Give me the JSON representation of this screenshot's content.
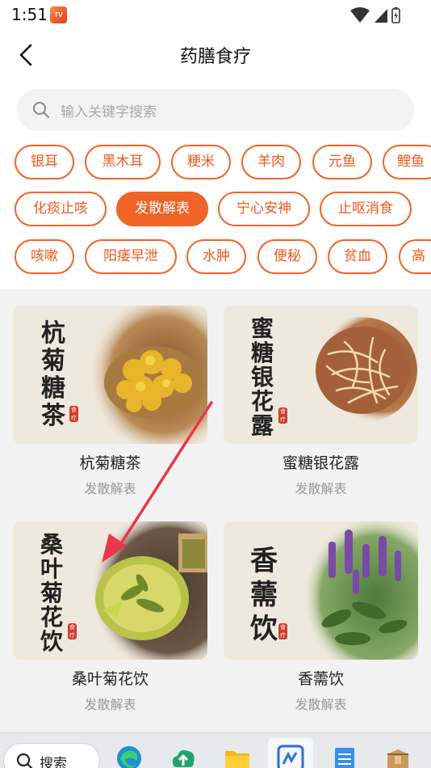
{
  "status": {
    "time": "1:51",
    "app_badge": "TV"
  },
  "header": {
    "title": "药膳食疗"
  },
  "search": {
    "placeholder": "输入关键字搜索"
  },
  "tag_rows": [
    [
      "银耳",
      "黑木耳",
      "粳米",
      "羊肉",
      "元鱼",
      "鲤鱼"
    ],
    [
      "化痰止咳",
      "发散解表",
      "宁心安神",
      "止呕消食"
    ],
    [
      "咳嗽",
      "阳痿早泄",
      "水肿",
      "便秘",
      "贫血",
      "高"
    ]
  ],
  "active_tag": "发散解表",
  "cards": [
    {
      "name": "杭菊糖茶",
      "category": "发散解表",
      "title_chars": [
        "杭",
        "菊",
        "糖",
        "茶"
      ],
      "seal": "食疗"
    },
    {
      "name": "蜜糖银花露",
      "category": "发散解表",
      "title_chars": [
        "蜜",
        "糖",
        "银",
        "花",
        "露"
      ],
      "seal": "食疗"
    },
    {
      "name": "桑叶菊花饮",
      "category": "发散解表",
      "title_chars": [
        "桑",
        "叶",
        "菊",
        "花",
        "饮"
      ],
      "seal": "食疗"
    },
    {
      "name": "香薷饮",
      "category": "发散解表",
      "title_chars": [
        "香",
        "薷",
        "饮"
      ],
      "seal": "食疗"
    }
  ],
  "taskbar": {
    "search_label": "搜索"
  },
  "colors": {
    "accent": "#f06428",
    "annotation_arrow": "#e8384a"
  }
}
